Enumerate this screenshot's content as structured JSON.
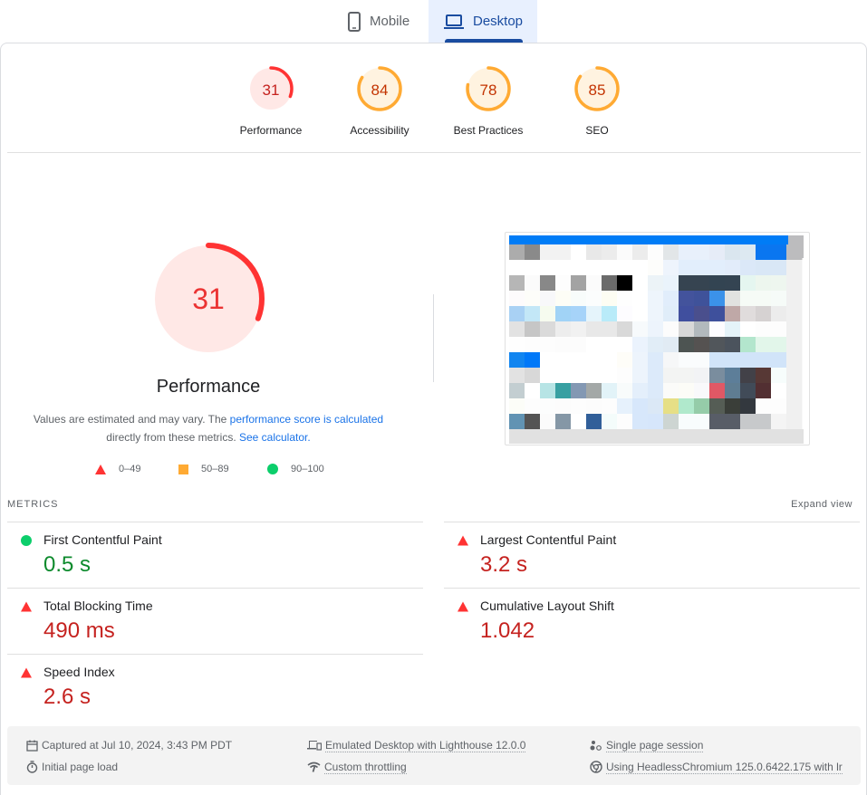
{
  "tabs": [
    {
      "label": "Mobile",
      "icon": "smartphone-icon",
      "active": false
    },
    {
      "label": "Desktop",
      "icon": "laptop-icon",
      "active": true
    }
  ],
  "categories": [
    {
      "label": "Performance",
      "score": 31,
      "rating": "fail"
    },
    {
      "label": "Accessibility",
      "score": 84,
      "rating": "average"
    },
    {
      "label": "Best Practices",
      "score": 78,
      "rating": "average"
    },
    {
      "label": "SEO",
      "score": 85,
      "rating": "average"
    }
  ],
  "performance": {
    "score": 31,
    "title": "Performance",
    "desc_prefix": "Values are estimated and may vary. The ",
    "desc_link": "performance score is calculated",
    "desc_middle": " directly from these metrics. ",
    "desc_link2": "See calculator.",
    "legend": [
      {
        "range": "0–49",
        "shape": "triangle",
        "color": "#ff3333"
      },
      {
        "range": "50–89",
        "shape": "square",
        "color": "#ffaa33"
      },
      {
        "range": "90–100",
        "shape": "circle",
        "color": "#0cce6b"
      }
    ]
  },
  "metrics": {
    "header": "METRICS",
    "expand_label": "Expand view",
    "items": [
      {
        "label": "First Contentful Paint",
        "value": "0.5 s",
        "rating": "pass"
      },
      {
        "label": "Largest Contentful Paint",
        "value": "3.2 s",
        "rating": "fail"
      },
      {
        "label": "Total Blocking Time",
        "value": "490 ms",
        "rating": "fail"
      },
      {
        "label": "Cumulative Layout Shift",
        "value": "1.042",
        "rating": "fail"
      },
      {
        "label": "Speed Index",
        "value": "2.6 s",
        "rating": "fail"
      }
    ]
  },
  "footer": {
    "captured": "Captured at Jul 10, 2024, 3:43 PM PDT",
    "initial_load": "Initial page load",
    "emulated": "Emulated Desktop with Lighthouse 12.0.0",
    "throttling": "Custom throttling",
    "session": "Single page session",
    "browser": "Using HeadlessChromium 125.0.6422.175 with lr"
  },
  "colors": {
    "fail": "#ff3333",
    "fail_bg": "#ffe8e6",
    "fail_text": "#c5221f",
    "average": "#ffaa33",
    "average_bg": "#fff3e0",
    "average_text": "#c33300",
    "pass": "#0cce6b",
    "accent": "#1a73e8"
  }
}
